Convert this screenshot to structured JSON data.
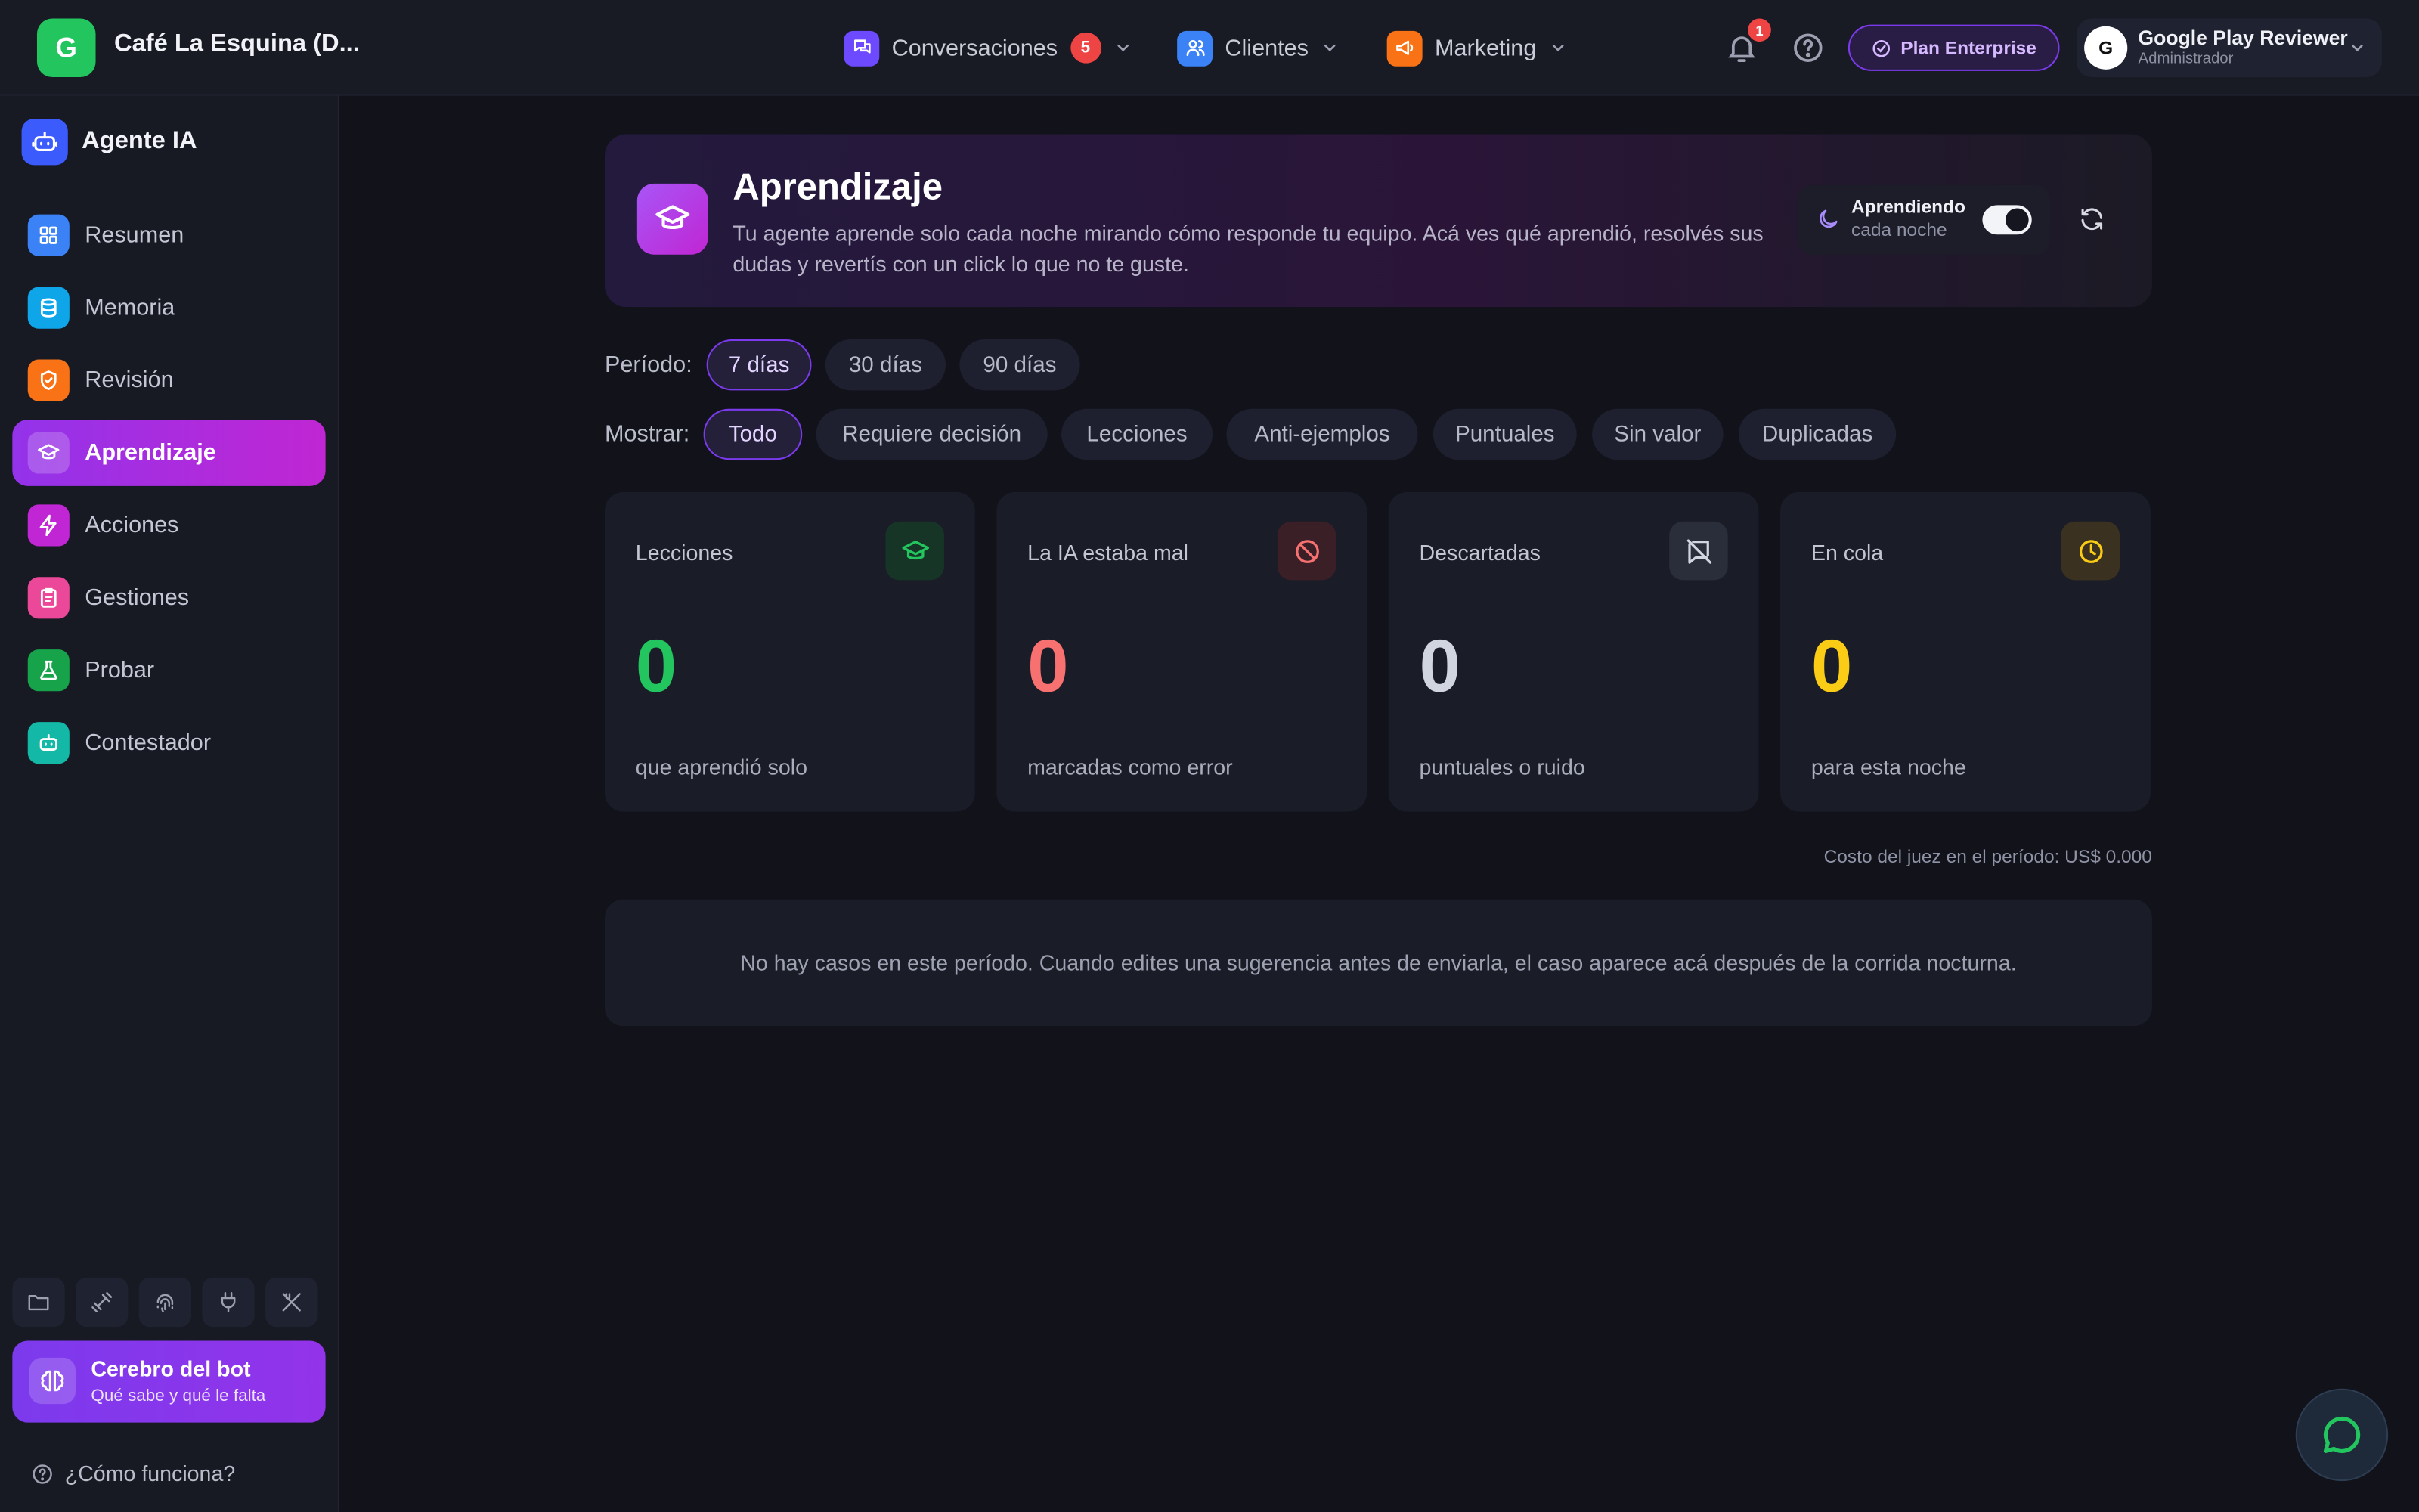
{
  "topbar": {
    "brand_initial": "G",
    "brand_name": "Café La Esquina (D...",
    "nav": [
      {
        "label": "Conversaciones",
        "badge": "5",
        "icon": "chat-icon",
        "color": "#6d4aff"
      },
      {
        "label": "Clientes",
        "icon": "users-icon",
        "color": "#3b82f6"
      },
      {
        "label": "Marketing",
        "icon": "megaphone-icon",
        "color": "#f97316"
      }
    ],
    "notifications_count": "1",
    "plan_label": "Plan Enterprise",
    "user": {
      "initial": "G",
      "name": "Google Play Reviewer",
      "role": "Administrador"
    }
  },
  "sidebar": {
    "title": "Agente IA",
    "items": [
      {
        "label": "Resumen",
        "icon": "grid-icon",
        "color": "#3b82f6"
      },
      {
        "label": "Memoria",
        "icon": "database-icon",
        "color": "#0ea5e9"
      },
      {
        "label": "Revisión",
        "icon": "shield-icon",
        "color": "#f97316"
      },
      {
        "label": "Aprendizaje",
        "icon": "graduation-cap-icon",
        "color": "#c026d3",
        "active": true
      },
      {
        "label": "Acciones",
        "icon": "bolt-icon",
        "color": "#c026d3"
      },
      {
        "label": "Gestiones",
        "icon": "clipboard-icon",
        "color": "#ec4899"
      },
      {
        "label": "Probar",
        "icon": "flask-icon",
        "color": "#16a34a"
      },
      {
        "label": "Contestador",
        "icon": "robot-icon",
        "color": "#14b8a6"
      }
    ],
    "tools": [
      "folder-icon",
      "dumbbell-icon",
      "fingerprint-icon",
      "plug-icon",
      "utensils-cross-icon"
    ],
    "cerebro": {
      "title": "Cerebro del bot",
      "subtitle": "Qué sabe y qué le falta"
    },
    "help_label": "¿Cómo funciona?"
  },
  "hero": {
    "title": "Aprendizaje",
    "description": "Tu agente aprende solo cada noche mirando cómo responde tu equipo. Acá ves qué aprendió, resolvés sus dudas y revertís con un click lo que no te guste.",
    "learning_title": "Aprendiendo",
    "learning_subtitle": "cada noche",
    "toggle_on": true
  },
  "filters": {
    "period_label": "Período:",
    "periods": [
      {
        "label": "7 días",
        "active": true
      },
      {
        "label": "30 días"
      },
      {
        "label": "90 días"
      }
    ],
    "show_label": "Mostrar:",
    "show": [
      {
        "label": "Todo",
        "active": true
      },
      {
        "label": "Requiere decisión"
      },
      {
        "label": "Lecciones"
      },
      {
        "label": "Anti-ejemplos"
      },
      {
        "label": "Puntuales"
      },
      {
        "label": "Sin valor"
      },
      {
        "label": "Duplicadas"
      }
    ]
  },
  "stats": [
    {
      "label": "Lecciones",
      "value": "0",
      "subtitle": "que aprendió solo",
      "icon": "graduation-cap-icon",
      "color": "#22c55e"
    },
    {
      "label": "La IA estaba mal",
      "value": "0",
      "subtitle": "marcadas como error",
      "icon": "ban-icon",
      "color": "#f87171"
    },
    {
      "label": "Descartadas",
      "value": "0",
      "subtitle": "puntuales o ruido",
      "icon": "message-off-icon",
      "color": "#d1d5e0"
    },
    {
      "label": "En cola",
      "value": "0",
      "subtitle": "para esta noche",
      "icon": "clock-icon",
      "color": "#facc15"
    }
  ],
  "cost_text": "Costo del juez en el período: US$ 0.000",
  "empty_text": "No hay casos en este período. Cuando edites una sugerencia antes de enviarla, el caso aparece acá después de la corrida nocturna."
}
